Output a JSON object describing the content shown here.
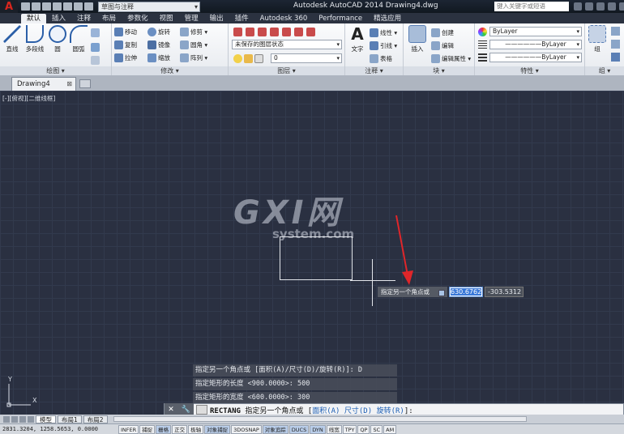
{
  "titlebar": {
    "workspace": "草图与注释",
    "app_title": "Autodesk AutoCAD 2014    Drawing4.dwg",
    "search_placeholder": "键入关键字或短语"
  },
  "ribbon_tabs": [
    "默认",
    "插入",
    "注释",
    "布局",
    "参数化",
    "视图",
    "管理",
    "输出",
    "插件",
    "Autodesk 360",
    "Performance",
    "精选应用"
  ],
  "ribbon": {
    "draw": {
      "title": "绘图 ▾",
      "line": "直线",
      "polyline": "多段线",
      "circle": "圆",
      "arc": "圆弧"
    },
    "modify": {
      "title": "修改 ▾",
      "move": "移动",
      "rotate": "旋转",
      "trim": "修剪 ▾",
      "copy": "复制",
      "mirror": "镜像",
      "fillet": "圆角 ▾",
      "stretch": "拉伸",
      "scale": "缩放",
      "array": "阵列 ▾"
    },
    "layers": {
      "title": "图层 ▾",
      "layer_state": "未保存的图层状态",
      "current_layer": "0"
    },
    "annotation": {
      "title": "注释 ▾",
      "text": "文字",
      "linear": "线性 ▾",
      "leader": "引线 ▾",
      "table": "表格"
    },
    "block": {
      "title": "块 ▾",
      "insert": "插入",
      "create": "创建",
      "edit": "编辑",
      "edit_attr": "编辑属性 ▾"
    },
    "properties": {
      "title": "特性 ▾",
      "color": "ByLayer",
      "linetype": "ByLayer",
      "lineweight": "ByLayer"
    },
    "groups": {
      "title": "组 ▾",
      "group": "组"
    }
  },
  "document": {
    "tab": "Drawing4",
    "viewport_label": "[-][俯视][二维线框]"
  },
  "watermark": {
    "main": "GXI网",
    "sub": "system.com"
  },
  "dynamic_input": {
    "prompt": "指定另一个角点或",
    "x_value": "630.6762",
    "y_value": "-303.5312"
  },
  "history": [
    "指定另一个角点或 [面积(A)/尺寸(D)/旋转(R)]: D",
    "指定矩形的长度 <900.0000>: 500",
    "指定矩形的宽度 <600.0000>: 300"
  ],
  "ucs": {
    "x": "X",
    "y": "Y"
  },
  "command": {
    "name": "RECTANG",
    "prompt": " 指定另一个角点或 [",
    "opt1": "面积(A)",
    "opt2": "尺寸(D)",
    "opt3": "旋转(R)",
    "tail": "]:"
  },
  "layout_tabs": [
    "模型",
    "布局1",
    "布局2"
  ],
  "status": {
    "coords": "2831.3204, 1258.5653, 0.0000",
    "buttons": [
      "INFER",
      "捕捉",
      "栅格",
      "正交",
      "极轴",
      "对象捕捉",
      "3DOSNAP",
      "对象追踪",
      "DUCS",
      "DYN",
      "线宽",
      "TPY",
      "QP",
      "SC",
      "AM"
    ]
  },
  "colors": {
    "canvas": "#2a3041",
    "accent_arrow": "#e0262a",
    "selection": "#3978d8"
  }
}
